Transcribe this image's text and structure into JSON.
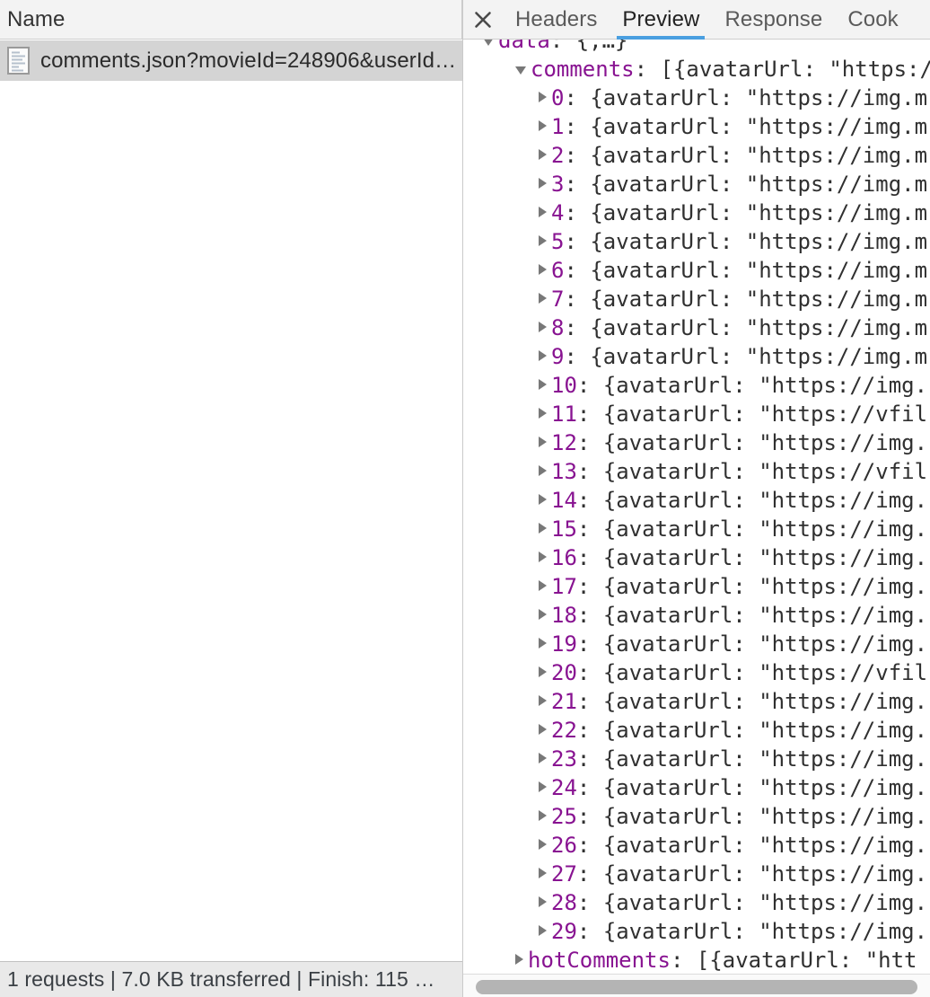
{
  "network_panel": {
    "columns": [
      {
        "label": "Name"
      }
    ],
    "requests": [
      {
        "icon": "document-icon",
        "name": "comments.json?movieId=248906&userId…",
        "selected": true
      }
    ],
    "status_bar": {
      "text": "1 requests | 7.0 KB transferred | Finish: 115 …"
    }
  },
  "detail_panel": {
    "close_icon": "close-icon",
    "tabs": [
      {
        "label": "Headers",
        "active": false
      },
      {
        "label": "Preview",
        "active": true
      },
      {
        "label": "Response",
        "active": false
      },
      {
        "label": "Cook",
        "active": false
      }
    ],
    "accent_color": "#4a9fe0",
    "key_color": "#881391",
    "value_color": "#303030",
    "preview_tree": [
      {
        "indent": 0,
        "arrow": "open",
        "key": "data",
        "sep": ": ",
        "value": "{,…}"
      },
      {
        "indent": 1,
        "arrow": "open",
        "key": "comments",
        "sep": ": ",
        "value": "[{avatarUrl: \"https:/"
      },
      {
        "indent": 2,
        "arrow": "closed",
        "key": "0",
        "sep": ": ",
        "value": "{avatarUrl: \"https://img.m"
      },
      {
        "indent": 2,
        "arrow": "closed",
        "key": "1",
        "sep": ": ",
        "value": "{avatarUrl: \"https://img.m"
      },
      {
        "indent": 2,
        "arrow": "closed",
        "key": "2",
        "sep": ": ",
        "value": "{avatarUrl: \"https://img.m"
      },
      {
        "indent": 2,
        "arrow": "closed",
        "key": "3",
        "sep": ": ",
        "value": "{avatarUrl: \"https://img.m"
      },
      {
        "indent": 2,
        "arrow": "closed",
        "key": "4",
        "sep": ": ",
        "value": "{avatarUrl: \"https://img.m"
      },
      {
        "indent": 2,
        "arrow": "closed",
        "key": "5",
        "sep": ": ",
        "value": "{avatarUrl: \"https://img.m"
      },
      {
        "indent": 2,
        "arrow": "closed",
        "key": "6",
        "sep": ": ",
        "value": "{avatarUrl: \"https://img.m"
      },
      {
        "indent": 2,
        "arrow": "closed",
        "key": "7",
        "sep": ": ",
        "value": "{avatarUrl: \"https://img.m"
      },
      {
        "indent": 2,
        "arrow": "closed",
        "key": "8",
        "sep": ": ",
        "value": "{avatarUrl: \"https://img.m"
      },
      {
        "indent": 2,
        "arrow": "closed",
        "key": "9",
        "sep": ": ",
        "value": "{avatarUrl: \"https://img.m"
      },
      {
        "indent": 2,
        "arrow": "closed",
        "key": "10",
        "sep": ": ",
        "value": "{avatarUrl: \"https://img."
      },
      {
        "indent": 2,
        "arrow": "closed",
        "key": "11",
        "sep": ": ",
        "value": "{avatarUrl: \"https://vfil"
      },
      {
        "indent": 2,
        "arrow": "closed",
        "key": "12",
        "sep": ": ",
        "value": "{avatarUrl: \"https://img."
      },
      {
        "indent": 2,
        "arrow": "closed",
        "key": "13",
        "sep": ": ",
        "value": "{avatarUrl: \"https://vfil"
      },
      {
        "indent": 2,
        "arrow": "closed",
        "key": "14",
        "sep": ": ",
        "value": "{avatarUrl: \"https://img."
      },
      {
        "indent": 2,
        "arrow": "closed",
        "key": "15",
        "sep": ": ",
        "value": "{avatarUrl: \"https://img."
      },
      {
        "indent": 2,
        "arrow": "closed",
        "key": "16",
        "sep": ": ",
        "value": "{avatarUrl: \"https://img."
      },
      {
        "indent": 2,
        "arrow": "closed",
        "key": "17",
        "sep": ": ",
        "value": "{avatarUrl: \"https://img."
      },
      {
        "indent": 2,
        "arrow": "closed",
        "key": "18",
        "sep": ": ",
        "value": "{avatarUrl: \"https://img."
      },
      {
        "indent": 2,
        "arrow": "closed",
        "key": "19",
        "sep": ": ",
        "value": "{avatarUrl: \"https://img."
      },
      {
        "indent": 2,
        "arrow": "closed",
        "key": "20",
        "sep": ": ",
        "value": "{avatarUrl: \"https://vfil"
      },
      {
        "indent": 2,
        "arrow": "closed",
        "key": "21",
        "sep": ": ",
        "value": "{avatarUrl: \"https://img."
      },
      {
        "indent": 2,
        "arrow": "closed",
        "key": "22",
        "sep": ": ",
        "value": "{avatarUrl: \"https://img."
      },
      {
        "indent": 2,
        "arrow": "closed",
        "key": "23",
        "sep": ": ",
        "value": "{avatarUrl: \"https://img."
      },
      {
        "indent": 2,
        "arrow": "closed",
        "key": "24",
        "sep": ": ",
        "value": "{avatarUrl: \"https://img."
      },
      {
        "indent": 2,
        "arrow": "closed",
        "key": "25",
        "sep": ": ",
        "value": "{avatarUrl: \"https://img."
      },
      {
        "indent": 2,
        "arrow": "closed",
        "key": "26",
        "sep": ": ",
        "value": "{avatarUrl: \"https://img."
      },
      {
        "indent": 2,
        "arrow": "closed",
        "key": "27",
        "sep": ": ",
        "value": "{avatarUrl: \"https://img."
      },
      {
        "indent": 2,
        "arrow": "closed",
        "key": "28",
        "sep": ": ",
        "value": "{avatarUrl: \"https://img."
      },
      {
        "indent": 2,
        "arrow": "closed",
        "key": "29",
        "sep": ": ",
        "value": "{avatarUrl: \"https://img."
      },
      {
        "indent": 1,
        "arrow": "closed",
        "key": "hotComments",
        "sep": ": ",
        "value": "[{avatarUrl: \"htt"
      }
    ]
  }
}
